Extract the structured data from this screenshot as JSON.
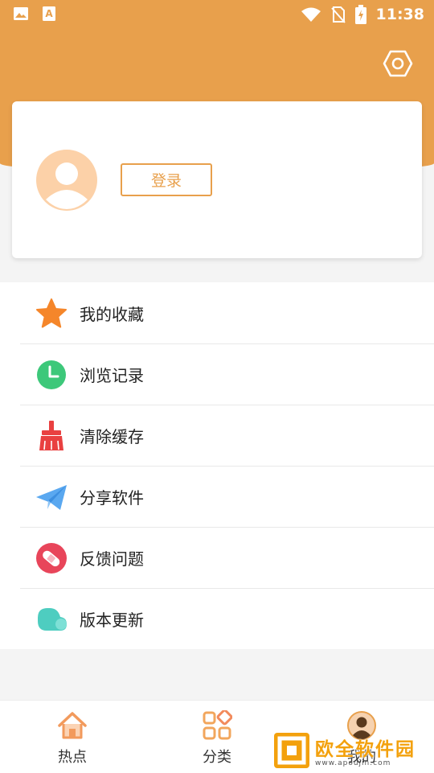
{
  "status_bar": {
    "time": "11:38",
    "icons": [
      "image-icon",
      "text-app-icon",
      "wifi-icon",
      "no-sim-icon",
      "battery-charging-icon"
    ]
  },
  "header": {
    "settings_icon": "hexagon-settings-icon"
  },
  "profile": {
    "login_label": "登录",
    "avatar_icon": "default-avatar-icon"
  },
  "menu": {
    "items": [
      {
        "label": "我的收藏",
        "icon": "star-icon",
        "color": "#f5862a"
      },
      {
        "label": "浏览记录",
        "icon": "clock-icon",
        "color": "#3dc87a"
      },
      {
        "label": "清除缓存",
        "icon": "broom-icon",
        "color": "#e94040"
      },
      {
        "label": "分享软件",
        "icon": "paper-plane-icon",
        "color": "#5aa8f0"
      },
      {
        "label": "反馈问题",
        "icon": "bandage-icon",
        "color": "#e8455a"
      },
      {
        "label": "版本更新",
        "icon": "cloud-icon",
        "color": "#4ecdc0"
      }
    ]
  },
  "bottom_nav": {
    "items": [
      {
        "label": "热点",
        "icon": "home-icon"
      },
      {
        "label": "分类",
        "icon": "grid-icon"
      },
      {
        "label": "我的",
        "icon": "user-avatar-icon",
        "active": true
      }
    ]
  },
  "watermark": {
    "title": "欧全软件园",
    "url": "www.apoujin.com"
  },
  "colors": {
    "accent": "#e8a04c",
    "background": "#f4f4f4"
  }
}
